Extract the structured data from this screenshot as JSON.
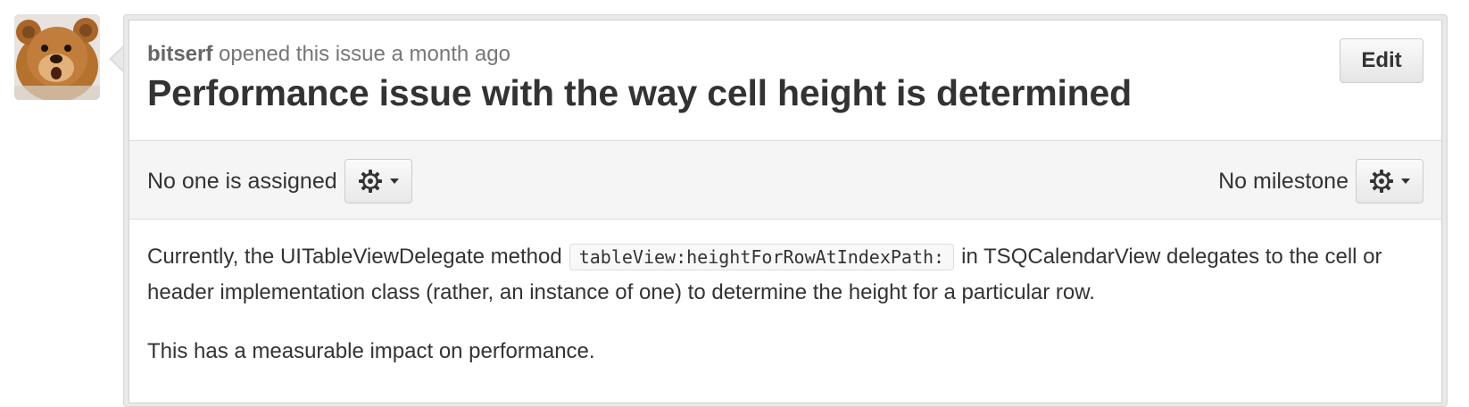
{
  "issue": {
    "author": "bitserf",
    "opened_text": " opened this issue a month ago",
    "title": "Performance issue with the way cell height is determined",
    "edit_label": "Edit"
  },
  "discussion_bar": {
    "assignee_text": "No one is assigned",
    "milestone_text": "No milestone"
  },
  "body": {
    "p1_before": "Currently, the UITableViewDelegate method",
    "p1_code": "tableView:heightForRowAtIndexPath:",
    "p1_after": "in TSQCalendarView delegates to the cell or header implementation class (rather, an instance of one) to determine the height for a particular row.",
    "p2": "This has a measurable impact on performance."
  },
  "icons": {
    "assignee_settings": "gear-icon",
    "milestone_settings": "gear-icon",
    "dropdown": "caret-down-icon"
  },
  "colors": {
    "title": "#333333",
    "meta": "#777777",
    "discussion_bar_bg": "#f5f5f5",
    "frame_bg": "#e9e9e9"
  }
}
